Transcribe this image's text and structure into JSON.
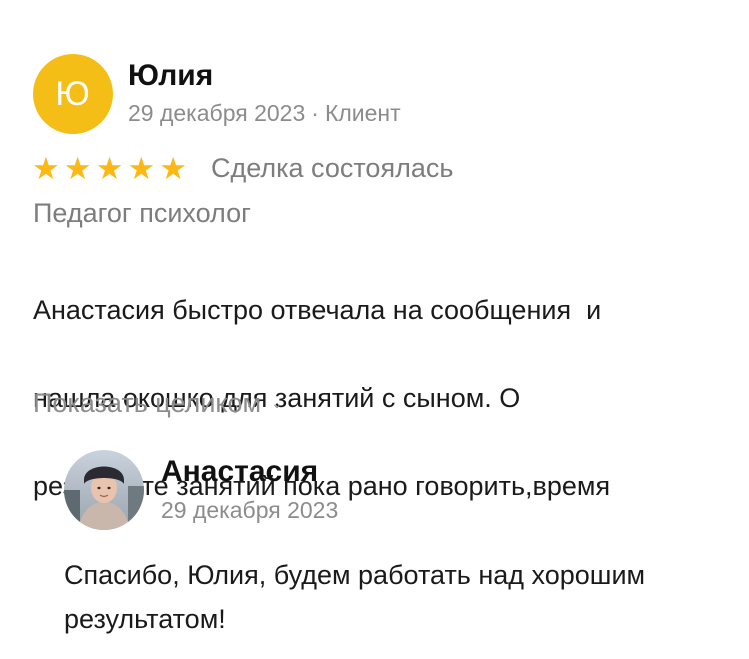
{
  "review": {
    "avatar_letter": "Ю",
    "avatar_color": "#f4be16",
    "author": "Юлия",
    "date": "29 декабря 2023",
    "role": "Клиент",
    "rating": 5,
    "rating_max": 5,
    "star_color": "#fdb813",
    "deal_status": "Сделка состоялась",
    "service": "Педагог психолог",
    "text_lines": [
      "Анастасия быстро отвечала на сообщения  и",
      "нашла окошко для занятий с сыном. О",
      "результате занятий пока рано говорить,время"
    ],
    "show_more": "Показать целиком"
  },
  "reply": {
    "author": "Анастасия",
    "date": "29 декабря 2023",
    "avatar_icon": "person-photo-icon",
    "text": "Спасибо, Юлия, будем работать над хорошим результатом!"
  }
}
